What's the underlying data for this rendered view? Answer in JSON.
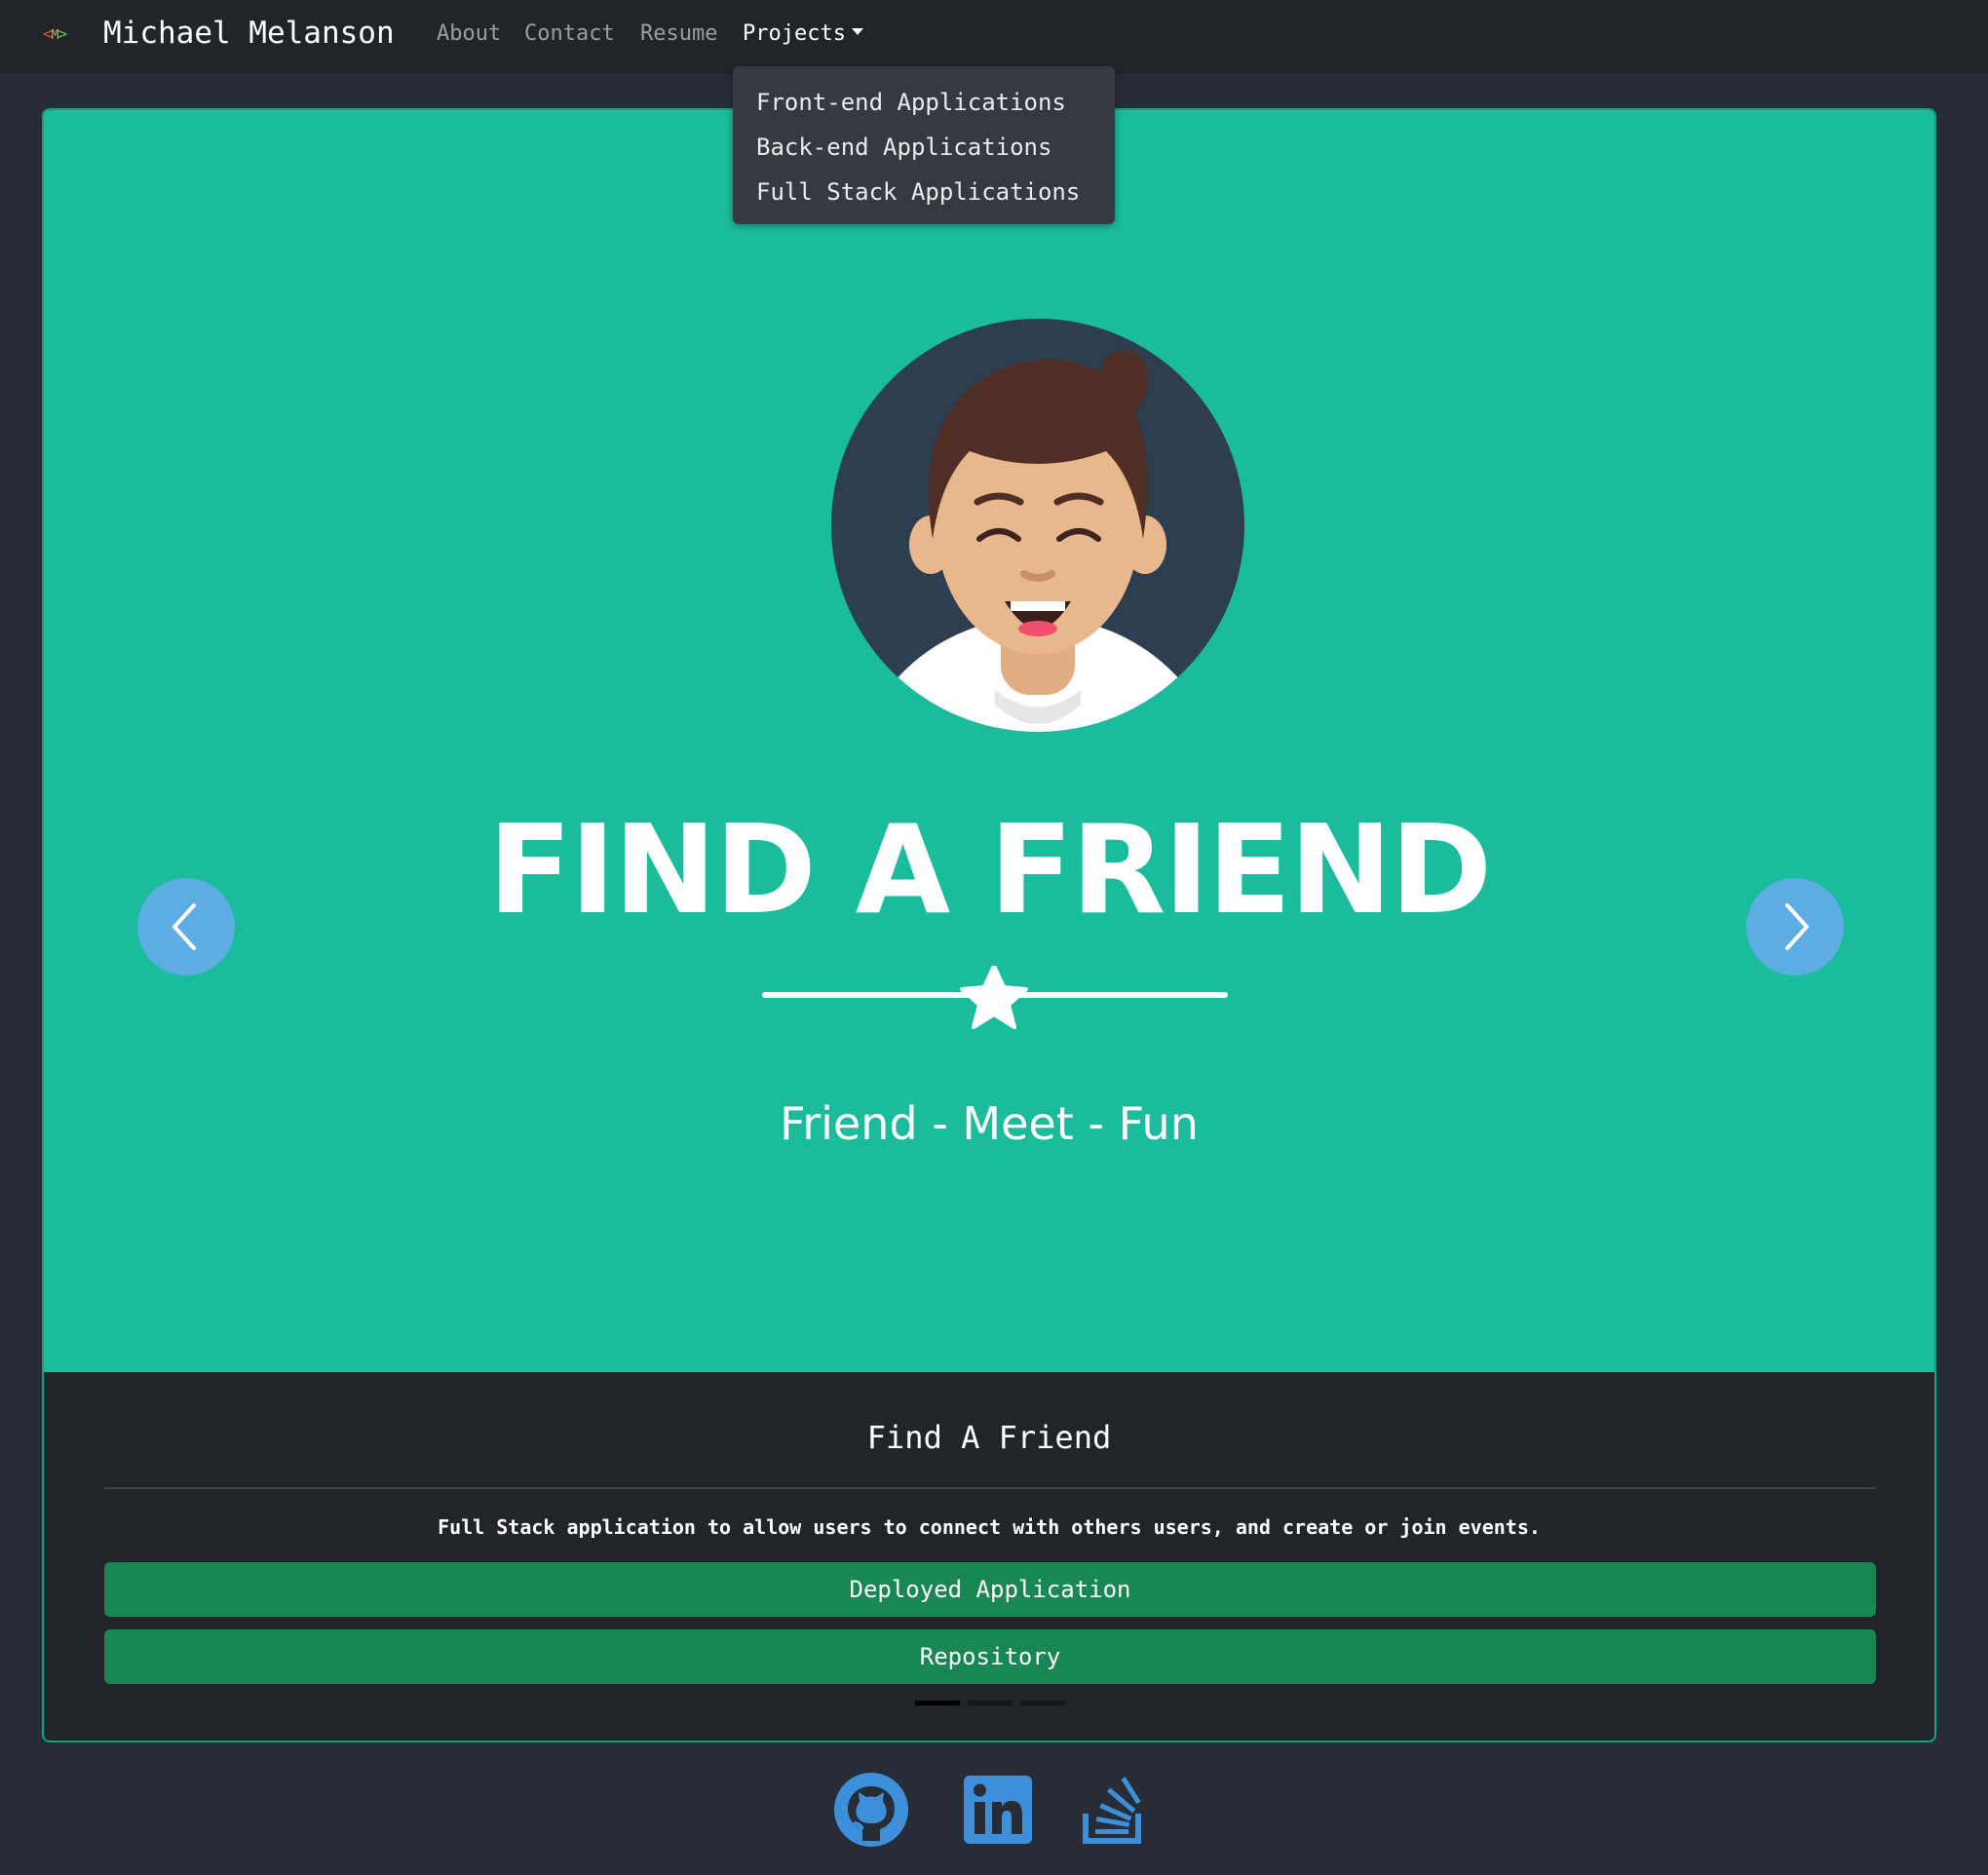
{
  "navbar": {
    "brand": "Michael Melanson",
    "logo": {
      "left": "<",
      "mid": "M",
      "right": ">",
      "icon": "code-logo-icon"
    },
    "links": [
      "About",
      "Contact",
      "Resume"
    ],
    "projects_label": "Projects"
  },
  "dropdown": {
    "items": [
      "Front-end Applications",
      "Back-end Applications",
      "Full Stack Applications"
    ]
  },
  "carousel": {
    "hero_title": "FIND A FRIEND",
    "hero_subtitle": "Friend - Meet - Fun",
    "hero_bg": "#1abc9c",
    "prev_icon": "chevron-left-icon",
    "next_icon": "chevron-right-icon",
    "button_color": "#5dade2",
    "caption_title": "Find A Friend",
    "caption_desc": "Full Stack application to allow users to connect with others users, and create or join events.",
    "deploy_label": "Deployed Application",
    "repo_label": "Repository",
    "button_green": "#198754",
    "slide_count": 3,
    "active_slide": 1
  },
  "footer": {
    "icons": [
      "github-icon",
      "linkedin-icon",
      "stackoverflow-icon"
    ],
    "icon_color": "#3d8fd9"
  }
}
